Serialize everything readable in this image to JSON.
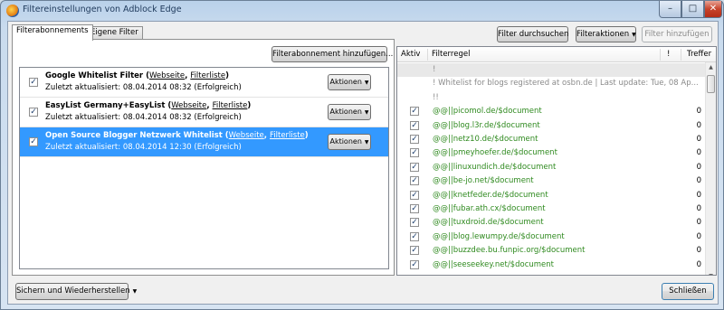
{
  "window": {
    "title": "Filtereinstellungen von Adblock Edge",
    "min_glyph": "–",
    "max_glyph": "□",
    "close_glyph": "✕"
  },
  "tabs": [
    {
      "label": "Filterabonnements",
      "active": true
    },
    {
      "label": "Eigene Filter",
      "active": false
    }
  ],
  "toolbar": {
    "add_subscription": "Filterabonnement hinzufügen...",
    "search_filter": "Filter durchsuchen",
    "filter_actions": "Filteraktionen",
    "add_filter": "Filter hinzufügen"
  },
  "subscriptions": [
    {
      "checked": true,
      "name": "Google Whitelist Filter",
      "link_website": "Webseite",
      "link_list": "Filterliste",
      "status": "Zuletzt aktualisiert:  08.04.2014 08:32 (Erfolgreich)",
      "actions": "Aktionen",
      "selected": false
    },
    {
      "checked": true,
      "name": "EasyList Germany+EasyList",
      "link_website": "Webseite",
      "link_list": "Filterliste",
      "status": "Zuletzt aktualisiert:  08.04.2014 08:32 (Erfolgreich)",
      "actions": "Aktionen",
      "selected": false
    },
    {
      "checked": true,
      "name": "Open Source Blogger Netzwerk Whitelist",
      "link_website": "Webseite",
      "link_list": "Filterliste",
      "status": "Zuletzt aktualisiert:  08.04.2014 12:30 (Erfolgreich)",
      "actions": "Aktionen",
      "selected": true
    }
  ],
  "filter_table": {
    "columns": {
      "active": "Aktiv",
      "rule": "Filterregel",
      "flag": "!",
      "hits": "Treffer"
    },
    "rows": [
      {
        "checkbox": false,
        "text": "!",
        "type": "comment",
        "hits": ""
      },
      {
        "checkbox": false,
        "text": "! Whitelist for blogs registered at osbn.de | Last update: Tue, 08 Ap...",
        "type": "comment",
        "hits": ""
      },
      {
        "checkbox": false,
        "text": "!!",
        "type": "comment",
        "hits": ""
      },
      {
        "checkbox": true,
        "text": "@@||picomol.de/$document",
        "type": "rule",
        "hits": "0"
      },
      {
        "checkbox": true,
        "text": "@@||blog.l3r.de/$document",
        "type": "rule",
        "hits": "0"
      },
      {
        "checkbox": true,
        "text": "@@||netz10.de/$document",
        "type": "rule",
        "hits": "0"
      },
      {
        "checkbox": true,
        "text": "@@||pmeyhoefer.de/$document",
        "type": "rule",
        "hits": "0"
      },
      {
        "checkbox": true,
        "text": "@@||linuxundich.de/$document",
        "type": "rule",
        "hits": "0"
      },
      {
        "checkbox": true,
        "text": "@@||be-jo.net/$document",
        "type": "rule",
        "hits": "0"
      },
      {
        "checkbox": true,
        "text": "@@||knetfeder.de/$document",
        "type": "rule",
        "hits": "0"
      },
      {
        "checkbox": true,
        "text": "@@||fubar.ath.cx/$document",
        "type": "rule",
        "hits": "0"
      },
      {
        "checkbox": true,
        "text": "@@||tuxdroid.de/$document",
        "type": "rule",
        "hits": "0"
      },
      {
        "checkbox": true,
        "text": "@@||blog.lewumpy.de/$document",
        "type": "rule",
        "hits": "0"
      },
      {
        "checkbox": true,
        "text": "@@||buzzdee.bu.funpic.org/$document",
        "type": "rule",
        "hits": "0"
      },
      {
        "checkbox": true,
        "text": "@@||seeseekey.net/$document",
        "type": "rule",
        "hits": "0"
      }
    ]
  },
  "footer": {
    "backup_restore": "Sichern und Wiederherstellen",
    "close": "Schließen"
  },
  "icons": {
    "check": "check-icon",
    "dropdown": "chevron-down-icon",
    "app": "adblock-edge-icon"
  }
}
